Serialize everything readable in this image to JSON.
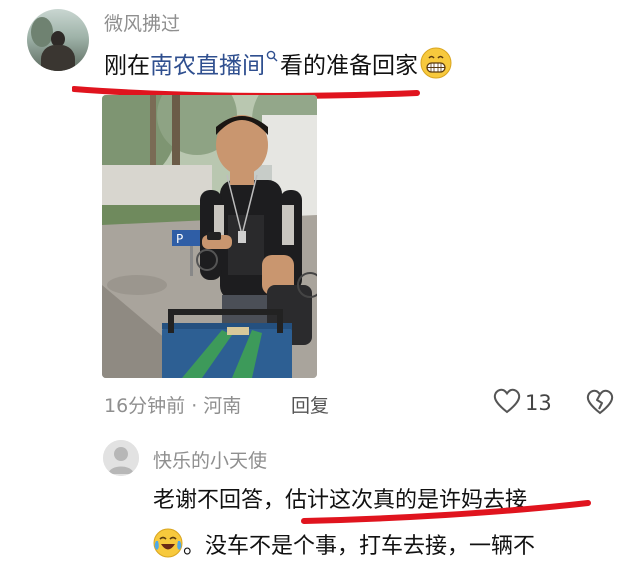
{
  "comment": {
    "username": "微风拂过",
    "text_before": "刚在",
    "link_text": "南农直播间",
    "text_after": "看的准备回家",
    "emoji_icon": "grinning-face-emoji",
    "meta_time": "16分钟前",
    "meta_sep": "·",
    "meta_location": "河南",
    "reply_label": "回复",
    "like_count": "13"
  },
  "reply": {
    "username": "快乐的小天使",
    "text_line1_plain": "老谢不回答，",
    "text_line1_highlight": "估计这次真的是许妈去接",
    "emoji_icon": "crying-laughing-emoji",
    "text_line2": "。没车不是个事，打车去接，一辆不"
  },
  "colors": {
    "link": "#2f4f8f",
    "annotation_red": "#e0141e",
    "meta_gray": "#8f8f8f"
  }
}
